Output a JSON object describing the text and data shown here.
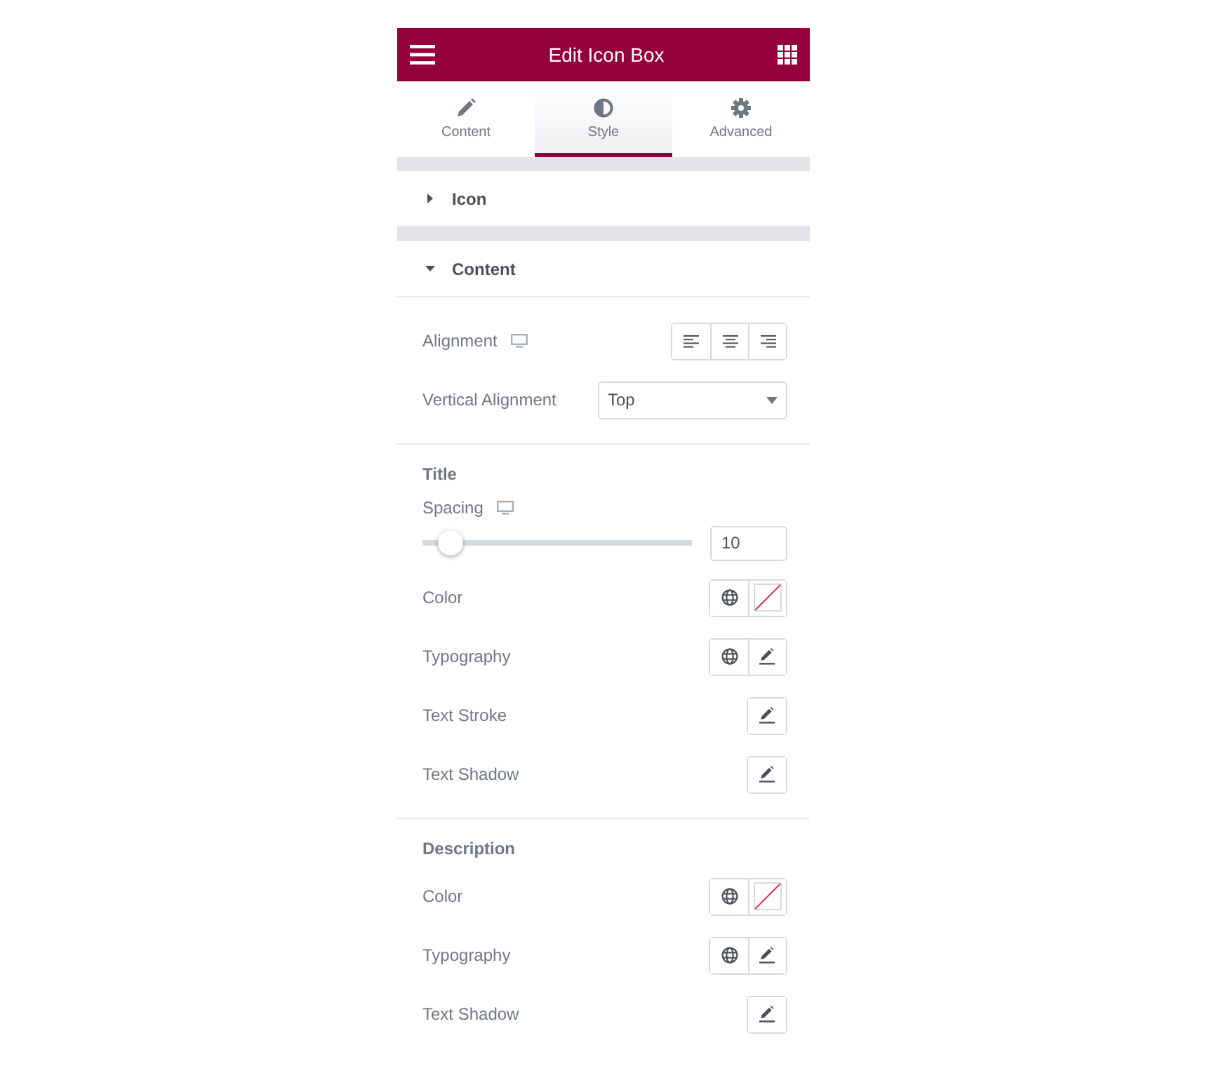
{
  "header": {
    "title": "Edit Icon Box"
  },
  "tabs": [
    {
      "label": "Content",
      "selected": false
    },
    {
      "label": "Style",
      "selected": true
    },
    {
      "label": "Advanced",
      "selected": false
    }
  ],
  "sections": [
    {
      "title": "Icon",
      "expanded": false
    },
    {
      "title": "Content",
      "expanded": true,
      "groups": [
        {
          "rows": [
            {
              "kind": "align",
              "label": "Alignment",
              "responsive": true
            },
            {
              "kind": "select",
              "label": "Vertical Alignment",
              "value": "Top"
            }
          ]
        },
        {
          "heading": "Title",
          "rows": [
            {
              "kind": "slider",
              "label": "Spacing",
              "responsive": true,
              "level": 0.1,
              "value": "10"
            },
            {
              "kind": "color",
              "label": "Color"
            },
            {
              "kind": "typography",
              "label": "Typography"
            },
            {
              "kind": "edit",
              "label": "Text Stroke"
            },
            {
              "kind": "edit",
              "label": "Text Shadow"
            }
          ]
        },
        {
          "heading": "Description",
          "rows": [
            {
              "kind": "color",
              "label": "Color"
            },
            {
              "kind": "typography",
              "label": "Typography"
            },
            {
              "kind": "edit",
              "label": "Text Shadow"
            }
          ]
        }
      ]
    }
  ]
}
